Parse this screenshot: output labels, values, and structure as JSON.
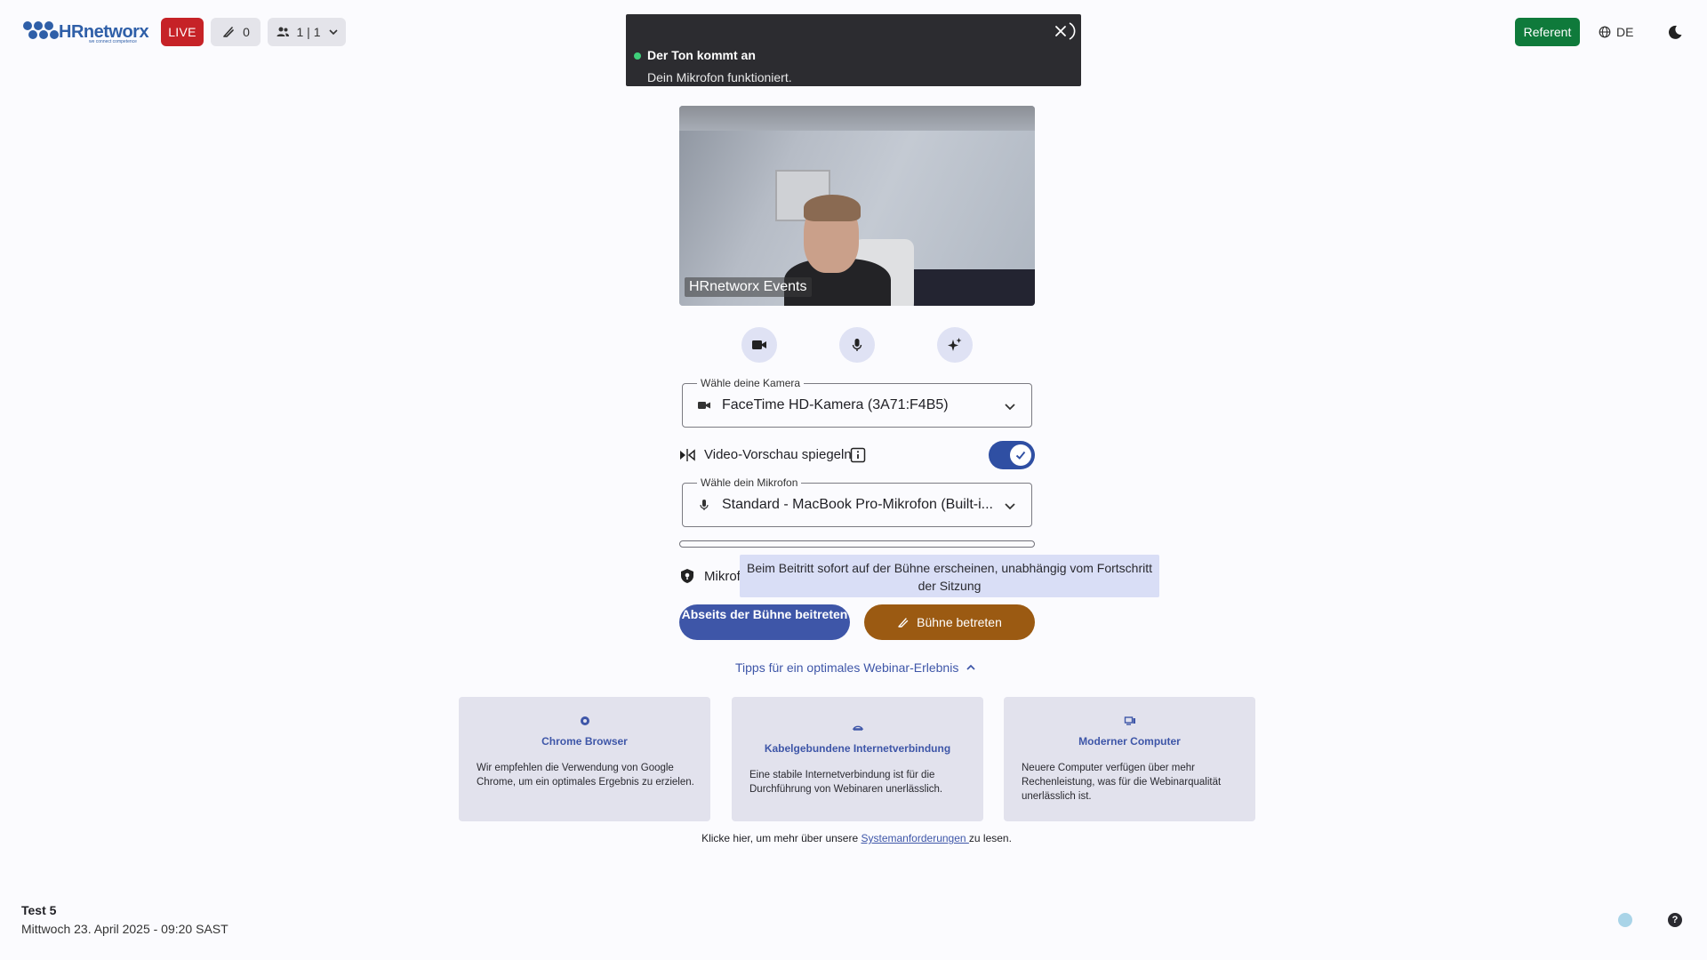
{
  "header": {
    "logo_text": "HRnetworx",
    "logo_tagline": "we connect competence",
    "live_label": "LIVE",
    "hand_count": "0",
    "participants_label": "1 | 1",
    "role_button": "Referent",
    "language": "DE"
  },
  "toast": {
    "title": "Der Ton kommt an",
    "message": "Dein Mikrofon funktioniert."
  },
  "video": {
    "name_label": "HRnetworx Events"
  },
  "camera_select": {
    "legend": "Wähle deine Kamera",
    "value": "FaceTime HD-Kamera (3A71:F4B5)"
  },
  "mirror": {
    "label": "Video-Vorschau spiegeln",
    "enabled": true
  },
  "mic_select": {
    "legend": "Wähle dein Mikrofon",
    "value": "Standard - MacBook Pro-Mikrofon (Built-i..."
  },
  "mic_check": {
    "label_visible": "Mikrof"
  },
  "tooltip": {
    "text": "Beim Beitritt sofort auf der Bühne erscheinen, unabhängig vom Fortschritt der Sitzung"
  },
  "buttons": {
    "side_stage": "Abseits der Bühne beitreten",
    "enter_stage": "Bühne betreten"
  },
  "tips": {
    "toggle_label": "Tipps für ein optimales Webinar-Erlebnis",
    "cards": [
      {
        "title": "Chrome Browser",
        "text": "Wir empfehlen die Verwendung von Google Chrome, um ein optimales Ergebnis zu erzielen."
      },
      {
        "title": "Kabelgebundene Internetverbindung",
        "text": "Eine stabile Internetverbindung ist für die Durchführung von Webinaren unerlässlich."
      },
      {
        "title": "Moderner Computer",
        "text": "Neuere Computer verfügen über mehr Rechenleistung, was für die Webinarqualität unerlässlich ist."
      }
    ],
    "sysreq_prefix": "Klicke hier, um mehr über unsere ",
    "sysreq_link": "Systemanforderungen ",
    "sysreq_suffix": "zu lesen."
  },
  "event": {
    "title": "Test 5",
    "date": "Mittwoch 23. April 2025 - 09:20 SAST"
  },
  "help_label": "?",
  "colors": {
    "live": "#c62227",
    "primary": "#3e56a8",
    "stage_button": "#9b5a12",
    "referent": "#0f7a3b",
    "toast_bg": "#2c2c30"
  }
}
